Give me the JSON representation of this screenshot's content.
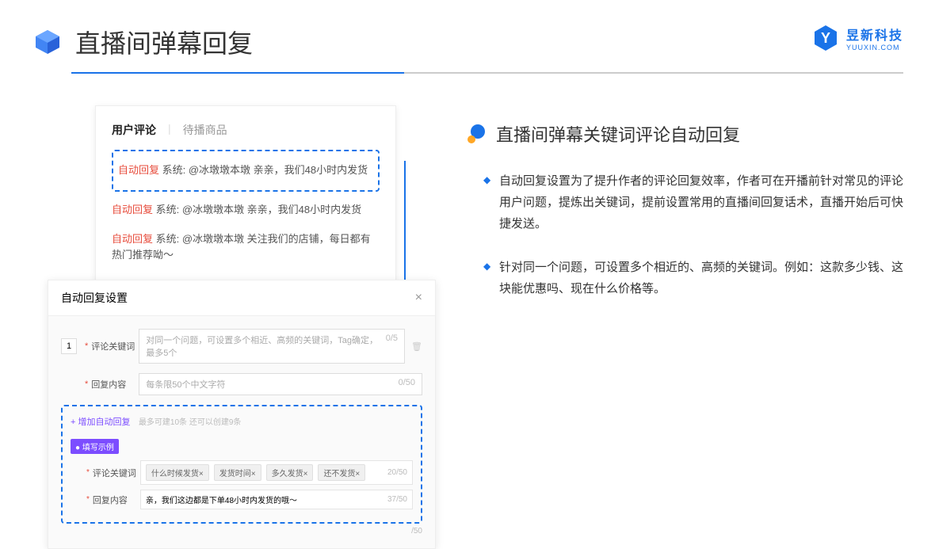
{
  "header": {
    "title": "直播间弹幕回复",
    "brand_name": "昱新科技",
    "brand_sub": "YUUXIN.COM"
  },
  "comments_card": {
    "tab_active": "用户评论",
    "tab_inactive": "待播商品",
    "rows": [
      {
        "prefix": "自动回复",
        "body": " 系统: @冰墩墩本墩 亲亲，我们48小时内发货"
      },
      {
        "prefix": "自动回复",
        "body": " 系统: @冰墩墩本墩 亲亲，我们48小时内发货"
      },
      {
        "prefix": "自动回复",
        "body": " 系统: @冰墩墩本墩 关注我们的店铺，每日都有热门推荐呦～"
      }
    ]
  },
  "settings": {
    "title": "自动回复设置",
    "num": "1",
    "keyword_label": "评论关键词",
    "keyword_placeholder": "对同一个问题，可设置多个相近、高频的关键词，Tag确定，最多5个",
    "keyword_count": "0/5",
    "content_label": "回复内容",
    "content_placeholder": "每条限50个中文字符",
    "content_count": "0/50",
    "add_link": "+ 增加自动回复",
    "add_note": "最多可建10条 还可以创建9条",
    "example_badge": "● 填写示例",
    "ex_keyword_label": "评论关键词",
    "ex_tags": [
      "什么时候发货×",
      "发货时间×",
      "多久发货×",
      "还不发货×"
    ],
    "ex_keyword_count": "20/50",
    "ex_content_label": "回复内容",
    "ex_content_value": "亲，我们这边都是下单48小时内发货的哦～",
    "ex_content_count": "37/50",
    "outer_count": "/50"
  },
  "right": {
    "section_title": "直播间弹幕关键词评论自动回复",
    "bullets": [
      "自动回复设置为了提升作者的评论回复效率，作者可在开播前针对常见的评论用户问题，提炼出关键词，提前设置常用的直播间回复话术，直播开始后可快捷发送。",
      "针对同一个问题，可设置多个相近的、高频的关键词。例如：这款多少钱、这块能优惠吗、现在什么价格等。"
    ]
  }
}
